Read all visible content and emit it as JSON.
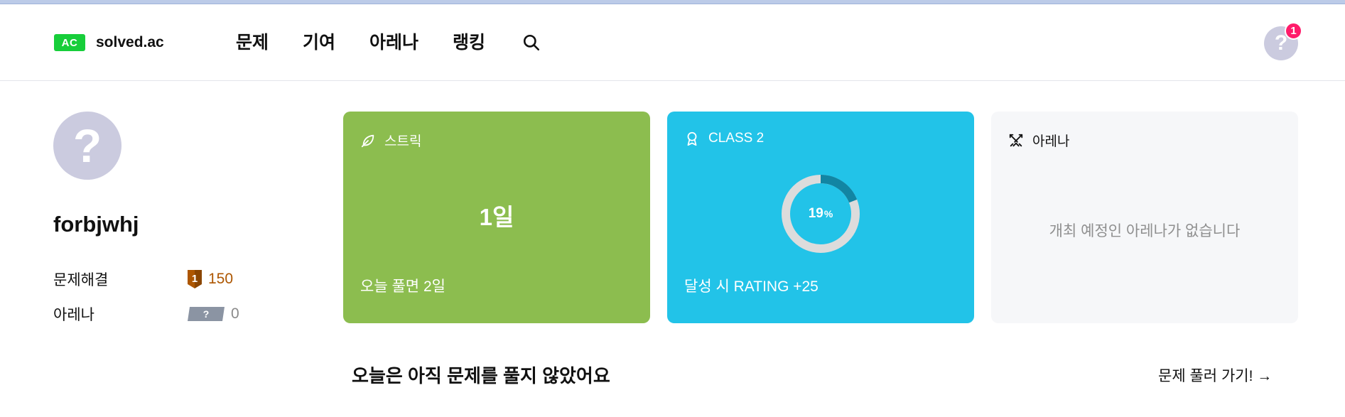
{
  "header": {
    "logo_badge": "AC",
    "logo_text": "solved.ac",
    "nav": [
      "문제",
      "기여",
      "아레나",
      "랭킹"
    ],
    "search_icon": "search-icon",
    "avatar_glyph": "?",
    "notification_count": "1"
  },
  "profile": {
    "avatar_glyph": "?",
    "username": "forbjwhj",
    "stats": [
      {
        "label": "문제해결",
        "value": "150",
        "tier_badge": "1"
      },
      {
        "label": "아레나",
        "value": "0",
        "tier_badge": "?"
      }
    ]
  },
  "cards": {
    "streak": {
      "title": "스트릭",
      "value": "1일",
      "footer": "오늘 풀면 2일",
      "icon": "leaf-icon"
    },
    "class": {
      "title": "CLASS 2",
      "progress": 19,
      "progress_label": "19",
      "progress_unit": "%",
      "footer": "달성 시 RATING +25",
      "icon": "badge-icon"
    },
    "arena": {
      "title": "아레나",
      "empty": "개최 예정인 아레나가 없습니다",
      "icon": "swords-icon"
    }
  },
  "today": {
    "message": "오늘은 아직 문제를 풀지 않았어요",
    "link": "문제 풀러 가기! →"
  },
  "colors": {
    "brand": "#17ce3a",
    "streak_card": "#8cbd4f",
    "class_card": "#22c3e8",
    "bronze": "#ad5600",
    "notification": "#ff1c6b"
  }
}
